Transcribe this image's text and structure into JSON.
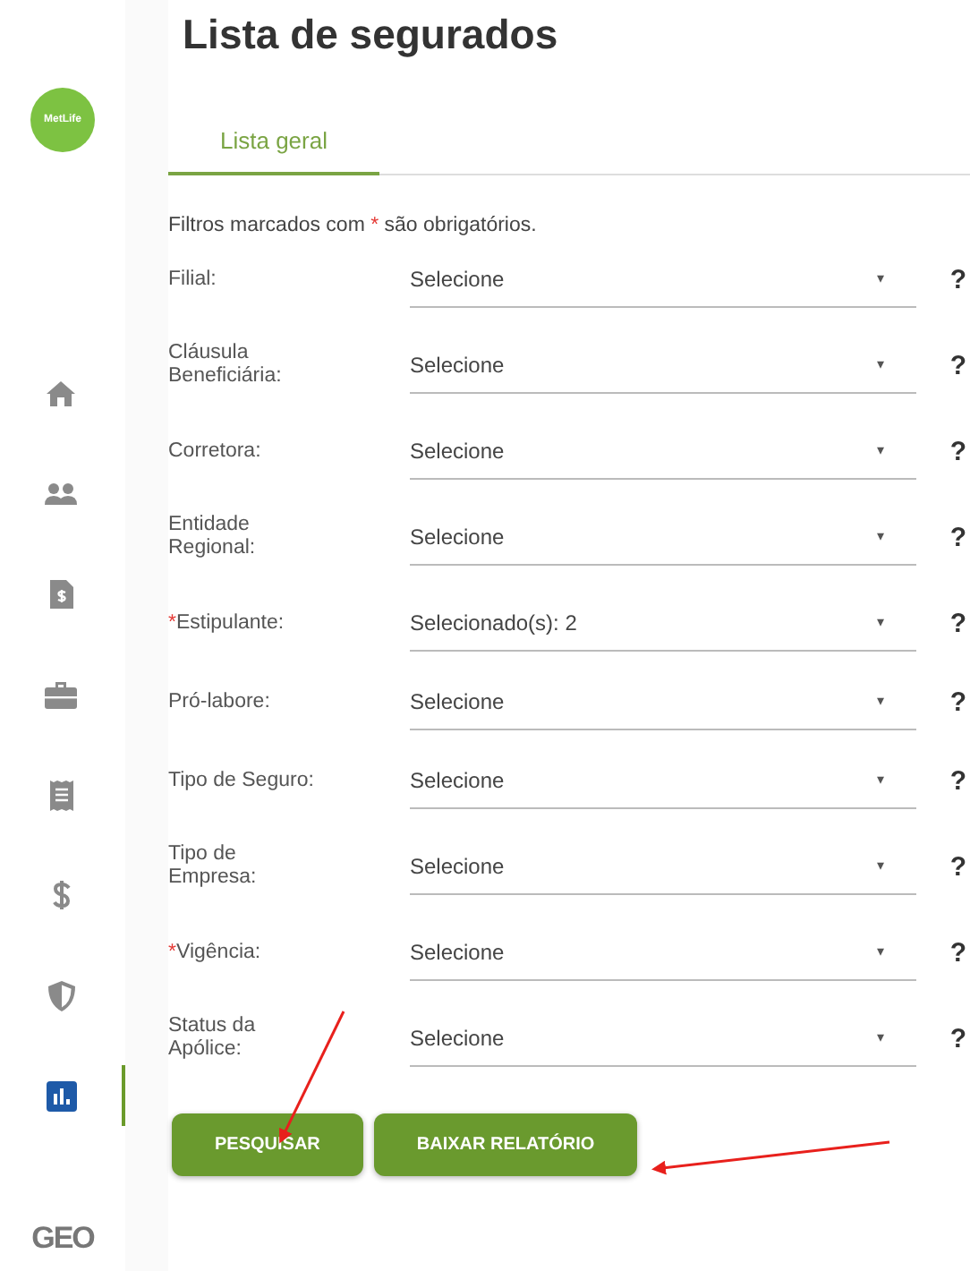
{
  "logo": "MetLife",
  "sidebar": {
    "items": [
      {
        "kind": "home",
        "selected": false
      },
      {
        "kind": "people",
        "selected": false
      },
      {
        "kind": "invoice",
        "selected": false
      },
      {
        "kind": "briefcase",
        "selected": false
      },
      {
        "kind": "receipt",
        "selected": false
      },
      {
        "kind": "dollar",
        "selected": false
      },
      {
        "kind": "shield",
        "selected": false
      },
      {
        "kind": "chart",
        "selected": true
      }
    ],
    "footer_logo": "GEO"
  },
  "title": "Lista de segurados",
  "tabs": [
    {
      "label": "Lista geral",
      "selected": true
    }
  ],
  "intro": {
    "before": "Filtros marcados com ",
    "mark": "*",
    "after": " são obrigatórios."
  },
  "fields": [
    {
      "label": "Filial:",
      "value": "Selecione",
      "arrow": "▾",
      "help": "?"
    },
    {
      "label": "Cláusula Beneficiária:",
      "value": "Selecione",
      "arrow": "▾",
      "help": "?"
    },
    {
      "label": "Corretora:",
      "value": "Selecione",
      "arrow": "▾",
      "help": "?"
    },
    {
      "label": "Entidade Regional:",
      "value": "Selecione",
      "arrow": "▾",
      "help": "?"
    },
    {
      "mark": "*",
      "label": "Estipulante:",
      "value": "Selecionado(s): 2",
      "arrow": "▾",
      "help": "?"
    },
    {
      "label": "Pró-labore:",
      "value": "Selecione",
      "arrow": "▾",
      "help": "?"
    },
    {
      "label": "Tipo de Seguro:",
      "value": "Selecione",
      "arrow": "▾",
      "help": "?"
    },
    {
      "label": "Tipo de Empresa:",
      "value": "Selecione",
      "arrow": "▾",
      "help": "?"
    },
    {
      "mark": "*",
      "label": "Vigência:",
      "value": "Selecione",
      "arrow": "▾",
      "help": "?"
    },
    {
      "label": "Status da Apólice:",
      "value": "Selecione",
      "arrow": "▾",
      "help": "?"
    }
  ],
  "buttons": [
    "PESQUISAR",
    "BAIXAR RELATÓRIO"
  ],
  "annotations": [
    {
      "kind": "arrow"
    },
    {
      "kind": "arrow"
    }
  ]
}
